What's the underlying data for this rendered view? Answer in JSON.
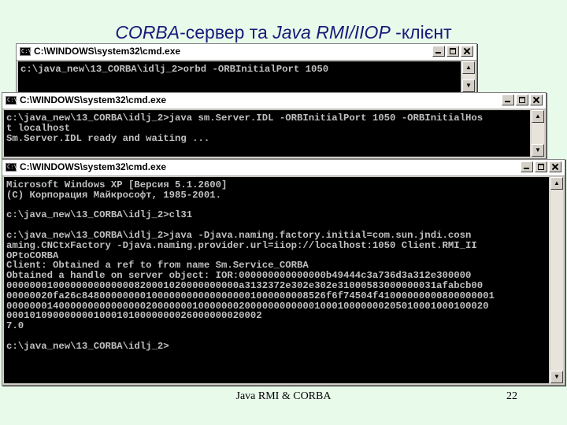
{
  "slide": {
    "title_part1": "CORBA",
    "title_part2": "-сервер та ",
    "title_part3": "Java RMI/IIOP",
    "title_part4": " -клієнт",
    "footer_text": "Java RMI & CORBA",
    "page_number": "22"
  },
  "windows": [
    {
      "title": "C:\\WINDOWS\\system32\\cmd.exe",
      "icon_text": "C:\\",
      "text": "c:\\java_new\\13_CORBA\\idlj_2>orbd -ORBInitialPort 1050"
    },
    {
      "title": "C:\\WINDOWS\\system32\\cmd.exe",
      "icon_text": "C:\\",
      "text": "c:\\java_new\\13_CORBA\\idlj_2>java sm.Server.IDL -ORBInitialPort 1050 -ORBInitialHos\nt localhost\nSm.Server.IDL ready and waiting ..."
    },
    {
      "title": "C:\\WINDOWS\\system32\\cmd.exe",
      "icon_text": "C:\\",
      "text": "Microsoft Windows XP [Версия 5.1.2600]\n(C) Корпорация Майкрософт, 1985-2001.\n\nc:\\java_new\\13_CORBA\\idlj_2>cl31\n\nc:\\java_new\\13_CORBA\\idlj_2>java -Djava.naming.factory.initial=com.sun.jndi.cosn\naming.CNCtxFactory -Djava.naming.provider.url=iiop://localhost:1050 Client.RMI_II\nOPtoCORBA\nClient: Obtained a ref to from name Sm.Service_CORBA\nObtained a handle on server object: IOR:000000000000000b49444c3a736d3a312e300000\n0000000100000000000000820001020000000000a3132372e302e302e31000583000000031afabcb00\n00000020fa26c848000000001000000000000000001000000008526f6f74504f41000000000800000001\n00000001400000000000000020000000100000002000000000000100010000000205010001000100020\n00010109000000010001010000000026000000020002\n7.0\n\nc:\\java_new\\13_CORBA\\idlj_2>"
    }
  ]
}
